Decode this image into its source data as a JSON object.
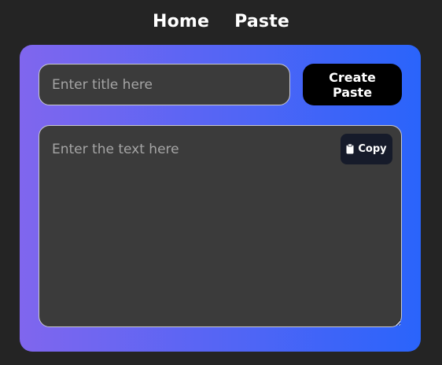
{
  "nav": {
    "items": [
      {
        "label": "Home"
      },
      {
        "label": "Paste"
      }
    ]
  },
  "form": {
    "title_placeholder": "Enter title here",
    "title_value": "",
    "create_label": "Create Paste",
    "text_placeholder": "Enter the text here",
    "text_value": "",
    "copy_label": "Copy",
    "copy_icon": "clipboard-icon"
  },
  "colors": {
    "page_background": "#242424",
    "card_gradient_start": "#8066ee",
    "card_gradient_end": "#2a64fb",
    "input_background": "#3b3b3b",
    "create_button_background": "#000000",
    "copy_button_background": "#161b2a"
  }
}
